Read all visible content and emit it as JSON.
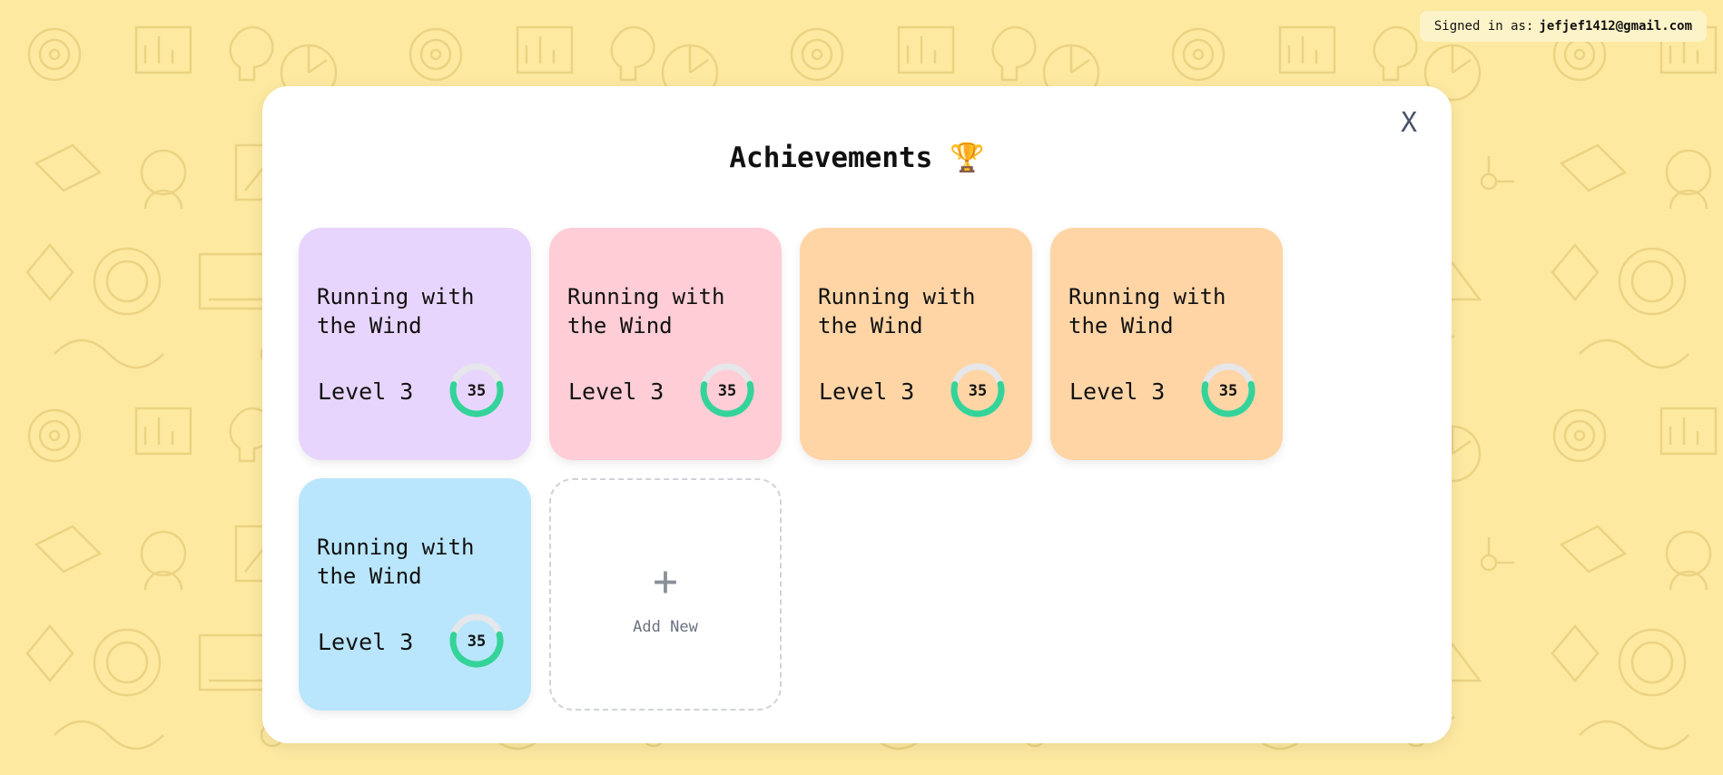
{
  "header": {
    "signed_in_prefix": "Signed in as:",
    "email": "jefjef1412@gmail.com"
  },
  "modal": {
    "title": "Achievements 🏆",
    "close_label": "X",
    "add_new_label": "Add New",
    "add_new_icon": "+",
    "cards": [
      {
        "name": "Running with the Wind",
        "level": "Level 3",
        "progress": 35,
        "progress_label": "35",
        "color": "#e8d5fd"
      },
      {
        "name": "Running with the Wind",
        "level": "Level 3",
        "progress": 35,
        "progress_label": "35",
        "color": "#ffcdd6"
      },
      {
        "name": "Running with the Wind",
        "level": "Level 3",
        "progress": 35,
        "progress_label": "35",
        "color": "#ffd5a6"
      },
      {
        "name": "Running with the Wind",
        "level": "Level 3",
        "progress": 35,
        "progress_label": "35",
        "color": "#ffd5a6"
      },
      {
        "name": "Running with the Wind",
        "level": "Level 3",
        "progress": 35,
        "progress_label": "35",
        "color": "#b9e6fc"
      }
    ]
  },
  "colors": {
    "background": "#fde9a0",
    "progress_fill": "#34d399",
    "progress_track": "#e5e7eb"
  }
}
